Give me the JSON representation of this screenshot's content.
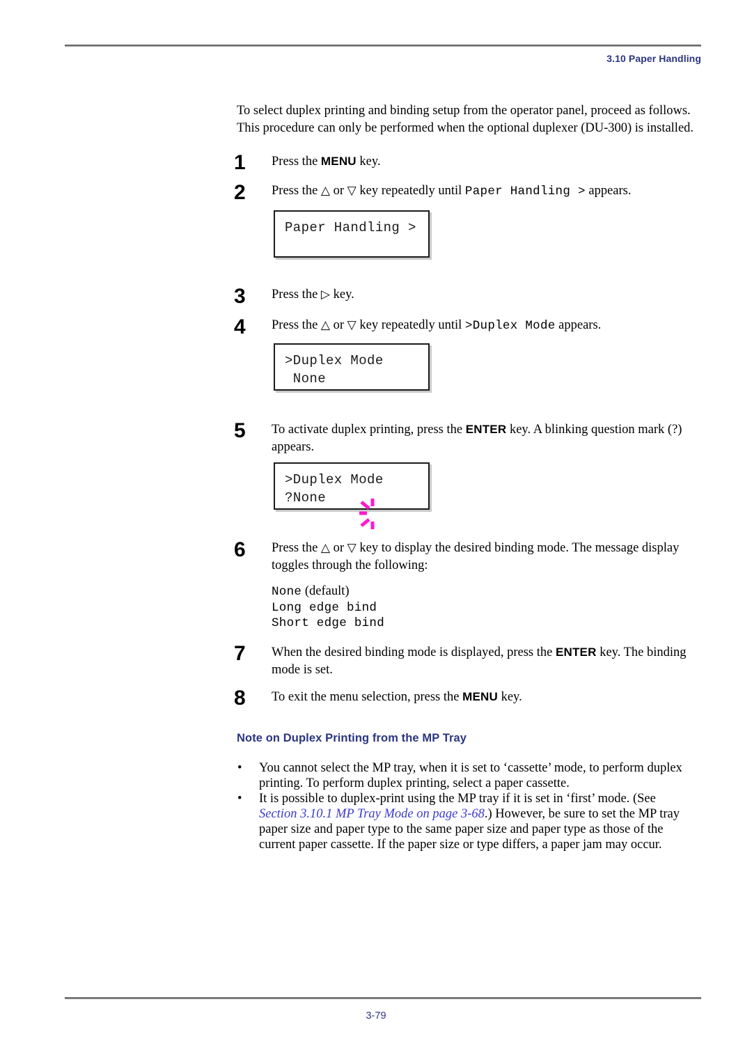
{
  "header": {
    "section_label": "3.10 Paper Handling",
    "accent_color": "#2b3581"
  },
  "intro": {
    "line1": "To select duplex printing and binding setup from the operator panel, proceed as follows.",
    "line2": "This procedure can only be performed when the optional duplexer (DU-300) is installed."
  },
  "steps": [
    {
      "number": "1",
      "text_before": "Press the ",
      "key": "MENU",
      "text_after": " key."
    },
    {
      "number": "2",
      "text_before": "Press the ",
      "up_key": "△",
      "or_text": " or ",
      "down_key": "▽",
      "text_middle": " key repeatedly until ",
      "mono_text": "Paper Handling >",
      "text_after": " appears."
    },
    {
      "number": "3",
      "text_before": "Press the ",
      "right_key": "▷",
      "text_after": " key."
    },
    {
      "number": "4",
      "text_before": "Press the ",
      "up_key": "△",
      "or_text": " or ",
      "down_key": "▽",
      "text_middle": " key repeatedly until ",
      "mono_text": ">Duplex Mode",
      "text_after": " appears."
    },
    {
      "number": "5",
      "text_before": "To activate duplex printing, press the ",
      "key": "ENTER",
      "text_after": " key. A blinking question mark (?) appears."
    },
    {
      "number": "6",
      "text": "Press the △ or ▽ key to display the desired binding mode. The message display toggles through the following:",
      "text_before": "Press the ",
      "up_key": "△",
      "or_text": " or ",
      "down_key": "▽",
      "text_after": " key to display the desired binding mode. The message display toggles through the following:"
    },
    {
      "number": "7",
      "text_before": "When the desired binding mode is displayed, press the ",
      "key": "ENTER",
      "text_after": " key. The binding mode is set."
    },
    {
      "number": "8",
      "text_before": "To exit the menu selection, press the ",
      "key": "MENU",
      "text_after": " key."
    }
  ],
  "lcd_panels": [
    {
      "id": "paper-handling",
      "line1": "Paper Handling >",
      "line2": ""
    },
    {
      "id": "duplex-mode-none",
      "line1": ">Duplex Mode",
      "line2": " None"
    },
    {
      "id": "duplex-mode-blinking",
      "line1": ">Duplex Mode",
      "line2_blink": "?",
      "line2_rest": "None",
      "blink_color": "#ff19cc"
    }
  ],
  "binding_modes": [
    {
      "value": "None",
      "note": " (default)"
    },
    {
      "value": "Long edge bind",
      "note": ""
    },
    {
      "value": "Short edge bind",
      "note": ""
    }
  ],
  "note_section": {
    "heading": "Note on Duplex Printing from the MP Tray",
    "bullet_marker": "•",
    "bullets": [
      {
        "text": "You cannot select the MP tray, when it is set to ‘cassette’ mode, to perform duplex printing. To perform duplex printing, select a paper cassette."
      },
      {
        "part1": "It is possible to duplex-print using the MP tray if it is set in ‘first’ mode. (See ",
        "xref": "Section 3.10.1 MP Tray Mode on page 3-68",
        "part2": ".) However, be sure to set the MP tray paper size and paper type to the same paper size and paper type as those of the current paper cassette. If the paper size or type differs, a paper jam may occur."
      }
    ]
  },
  "footer": {
    "page_number": "3-79"
  }
}
